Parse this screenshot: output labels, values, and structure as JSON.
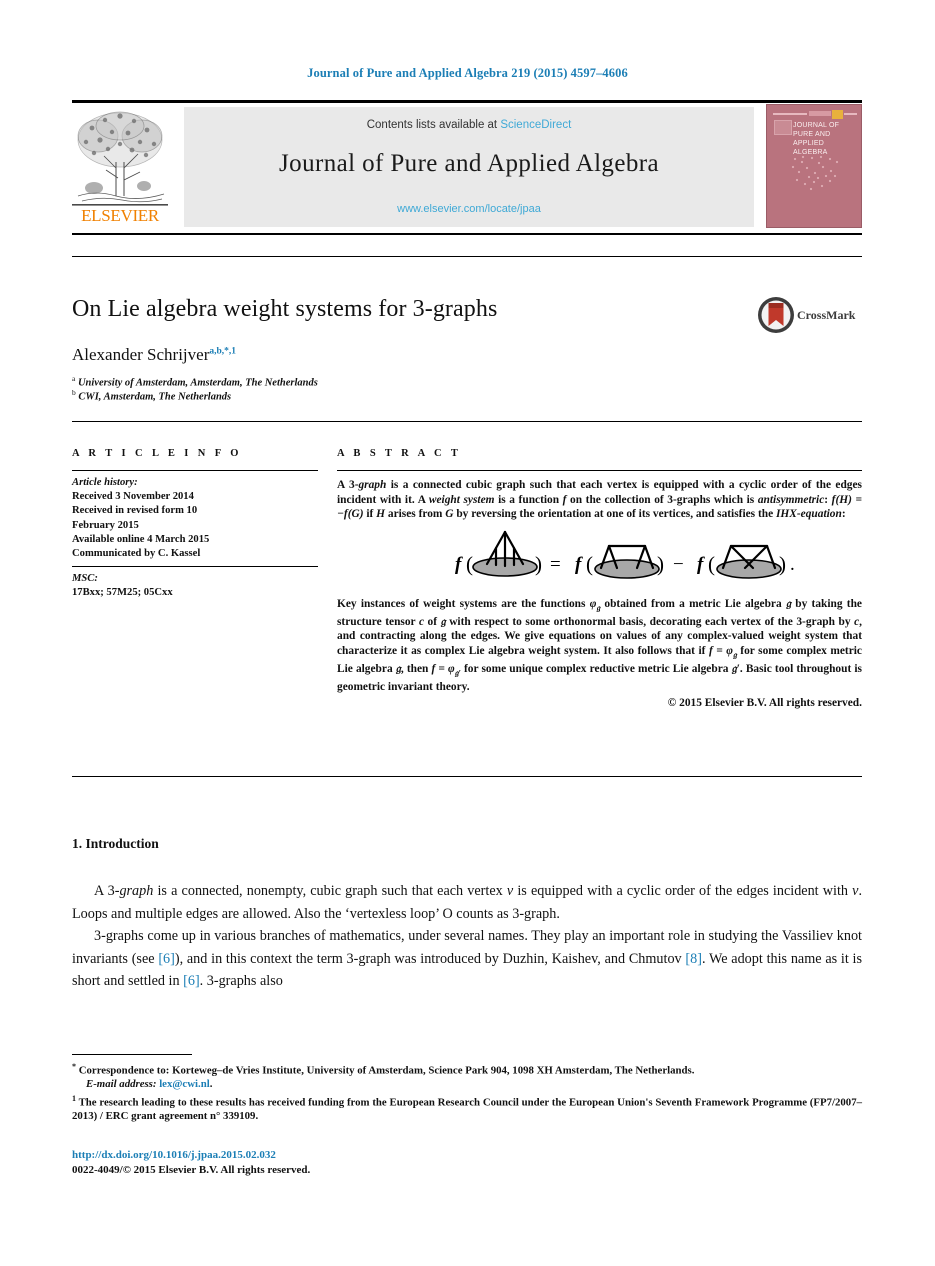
{
  "running_head": "Journal of Pure and Applied Algebra 219 (2015) 4597–4606",
  "masthead": {
    "contents_prefix": "Contents lists available at ",
    "sciencedirect_link": "ScienceDirect",
    "journal_name": "Journal of Pure and Applied Algebra",
    "journal_url": "www.elsevier.com/locate/jpaa",
    "publisher_wordmark": "ELSEVIER",
    "cover_title": "JOURNAL OF PURE AND APPLIED ALGEBRA",
    "colors": {
      "link_blue": "#3fa9d6",
      "banner_gray": "#e9e9e9",
      "elsevier_orange": "#f08000",
      "cover_rose": "#b9737e"
    }
  },
  "crossmark": {
    "label": "CrossMark"
  },
  "article": {
    "title": "On Lie algebra weight systems for 3-graphs",
    "author": "Alexander Schrijver",
    "author_marks": "a,b,*,1",
    "affiliations": [
      {
        "mark": "a",
        "text": "University of Amsterdam, Amsterdam, The Netherlands"
      },
      {
        "mark": "b",
        "text": "CWI, Amsterdam, The Netherlands"
      }
    ]
  },
  "info": {
    "heading": "A R T I C L E   I N F O",
    "history_label": "Article history:",
    "history": [
      "Received 3 November 2014",
      "Received in revised form 10",
      "February 2015",
      "Available online 4 March 2015",
      "Communicated by C. Kassel"
    ],
    "msc_label": "MSC:",
    "msc_value": "17Bxx; 57M25; 05Cxx"
  },
  "abstract": {
    "heading": "A B S T R A C T",
    "paragraph_1_parts": [
      {
        "t": "A 3-",
        "s": "n"
      },
      {
        "t": "graph",
        "s": "i"
      },
      {
        "t": " is a connected cubic graph such that each vertex is equipped with a cyclic order of the edges incident with it. A ",
        "s": "n"
      },
      {
        "t": "weight system",
        "s": "i"
      },
      {
        "t": " is a function ",
        "s": "n"
      },
      {
        "t": "f",
        "s": "m"
      },
      {
        "t": " on the collection of 3-graphs which is ",
        "s": "n"
      },
      {
        "t": "antisymmetric",
        "s": "i"
      },
      {
        "t": ": ",
        "s": "n"
      },
      {
        "t": "f(H) = −f(G)",
        "s": "m"
      },
      {
        "t": " if ",
        "s": "n"
      },
      {
        "t": "H",
        "s": "m"
      },
      {
        "t": " arises from ",
        "s": "n"
      },
      {
        "t": "G",
        "s": "m"
      },
      {
        "t": " by reversing the orientation at one of its vertices, and satisfies the ",
        "s": "n"
      },
      {
        "t": "IHX-equation",
        "s": "i"
      },
      {
        "t": ":",
        "s": "n"
      }
    ],
    "equation_alt": "f(I-diagram) = f(H-diagram) − f(X-diagram).",
    "paragraph_2_parts": [
      {
        "t": "Key instances of weight systems are the functions ",
        "s": "n"
      },
      {
        "t": "φ",
        "s": "m"
      },
      {
        "t": "𝔤",
        "s": "sub"
      },
      {
        "t": " obtained from a metric Lie algebra ",
        "s": "n"
      },
      {
        "t": "𝔤",
        "s": "m"
      },
      {
        "t": " by taking the structure tensor ",
        "s": "n"
      },
      {
        "t": "c",
        "s": "m"
      },
      {
        "t": " of ",
        "s": "n"
      },
      {
        "t": "𝔤",
        "s": "m"
      },
      {
        "t": " with respect to some orthonormal basis, decorating each vertex of the 3-graph by ",
        "s": "n"
      },
      {
        "t": "c",
        "s": "m"
      },
      {
        "t": ", and contracting along the edges. We give equations on values of any complex-valued weight system that characterize it as complex Lie algebra weight system. It also follows that if ",
        "s": "n"
      },
      {
        "t": "f = φ",
        "s": "m"
      },
      {
        "t": "𝔤",
        "s": "sub"
      },
      {
        "t": " for some complex metric Lie algebra ",
        "s": "n"
      },
      {
        "t": "𝔤",
        "s": "m"
      },
      {
        "t": ", then ",
        "s": "n"
      },
      {
        "t": "f = φ",
        "s": "m"
      },
      {
        "t": "𝔤′",
        "s": "sub"
      },
      {
        "t": " for some unique complex reductive metric Lie algebra ",
        "s": "n"
      },
      {
        "t": "𝔤′",
        "s": "m"
      },
      {
        "t": ". Basic tool throughout is geometric invariant theory.",
        "s": "n"
      }
    ],
    "copyright": "© 2015 Elsevier B.V. All rights reserved."
  },
  "body": {
    "section_number_title": "1. Introduction",
    "paragraph_1_parts": [
      {
        "t": "A 3-",
        "s": "n"
      },
      {
        "t": "graph",
        "s": "i"
      },
      {
        "t": " is a connected, nonempty, cubic graph such that each vertex ",
        "s": "n"
      },
      {
        "t": "v",
        "s": "m"
      },
      {
        "t": " is equipped with a cyclic order of the edges incident with ",
        "s": "n"
      },
      {
        "t": "v",
        "s": "m"
      },
      {
        "t": ". Loops and multiple edges are allowed. Also the ‘vertexless loop’ O counts as 3-graph.",
        "s": "n"
      }
    ],
    "paragraph_2_parts": [
      {
        "t": "3-graphs come up in various branches of mathematics, under several names. They play an important role in studying the Vassiliev knot invariants (see ",
        "s": "n"
      },
      {
        "t": "[6]",
        "s": "c"
      },
      {
        "t": "), and in this context the term 3-graph was introduced by Duzhin, Kaishev, and Chmutov ",
        "s": "n"
      },
      {
        "t": "[8]",
        "s": "c"
      },
      {
        "t": ". We adopt this name as it is short and settled in ",
        "s": "n"
      },
      {
        "t": "[6]",
        "s": "c"
      },
      {
        "t": ". 3-graphs also",
        "s": "n"
      }
    ]
  },
  "footnotes": {
    "correspondence_mark": "*",
    "correspondence": "Correspondence to: Korteweg–de Vries Institute, University of Amsterdam, Science Park 904, 1098 XH Amsterdam, The Netherlands.",
    "email_label": "E-mail address:",
    "email": "lex@cwi.nl",
    "email_period": ".",
    "funding_mark": "1",
    "funding": "The research leading to these results has received funding from the European Research Council under the European Union's Seventh Framework Programme (FP7/2007–2013) / ERC grant agreement n° 339109."
  },
  "footer": {
    "doi": "http://dx.doi.org/10.1016/j.jpaa.2015.02.032",
    "issn_line": "0022-4049/© 2015 Elsevier B.V. All rights reserved."
  }
}
